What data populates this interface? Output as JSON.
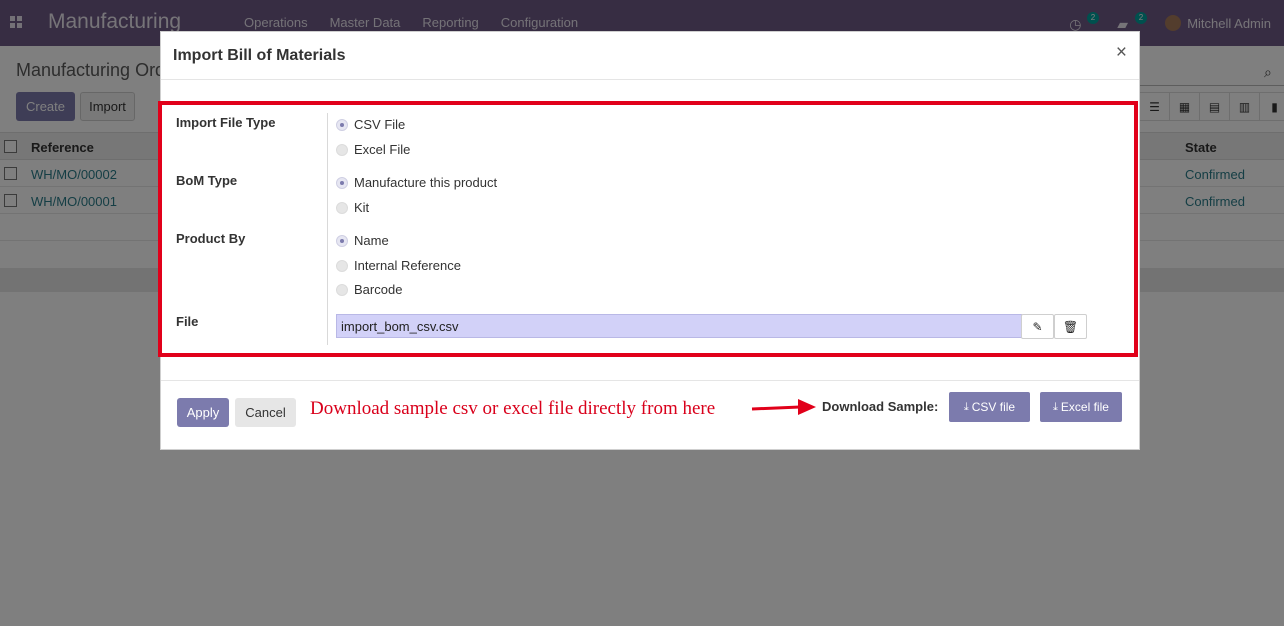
{
  "navbar": {
    "app_title": "Manufacturing",
    "menu": [
      "Operations",
      "Master Data",
      "Reporting",
      "Configuration"
    ],
    "activity_count": "2",
    "messages_count": "2",
    "user_name": "Mitchell Admin"
  },
  "control_panel": {
    "title": "Manufacturing Orders",
    "create_label": "Create",
    "import_label": "Import"
  },
  "list": {
    "headers": {
      "reference": "Reference",
      "state": "State"
    },
    "rows": [
      {
        "reference": "WH/MO/00002",
        "state": "Confirmed"
      },
      {
        "reference": "WH/MO/00001",
        "state": "Confirmed"
      }
    ]
  },
  "dialog": {
    "title": "Import Bill of Materials",
    "close_label": "×",
    "import_file_type": {
      "label": "Import File Type",
      "options": [
        "CSV File",
        "Excel File"
      ],
      "selected": "CSV File"
    },
    "bom_type": {
      "label": "BoM Type",
      "options": [
        "Manufacture this product",
        "Kit"
      ],
      "selected": "Manufacture this product"
    },
    "product_by": {
      "label": "Product By",
      "options": [
        "Name",
        "Internal Reference",
        "Barcode"
      ],
      "selected": "Name"
    },
    "file": {
      "label": "File",
      "value": "import_bom_csv.csv"
    },
    "footer": {
      "apply_label": "Apply",
      "cancel_label": "Cancel",
      "annotation": "Download sample csv or excel file directly from here",
      "download_label": "Download Sample:",
      "csv_label": "CSV file",
      "excel_label": "Excel file"
    }
  },
  "colors": {
    "navbar": "#6f5a86",
    "primary": "#7c7bad",
    "annotation_red": "#e1001a",
    "file_field": "#d2d1f8"
  }
}
